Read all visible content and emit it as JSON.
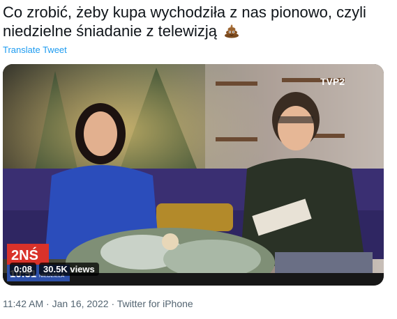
{
  "tweet": {
    "text": "Co zrobić, żeby kupa wychodziła z nas pionowo, czyli niedzielne śniadanie z telewizją",
    "emoji_icon": "pile-of-poo-icon",
    "translate_label": "Translate Tweet"
  },
  "video": {
    "duration": "0:08",
    "views": "30.5K views",
    "channel_logo": "TVP2",
    "show_logo": "2NŚ",
    "clock": "10:51",
    "clock_day": "NIEDZIELA"
  },
  "meta": {
    "time": "11:42 AM",
    "separator": "·",
    "date": "Jan 16, 2022",
    "source": "Twitter for iPhone"
  },
  "colors": {
    "link": "#1d9bf0",
    "secondary": "#536471",
    "text": "#0f1419"
  }
}
